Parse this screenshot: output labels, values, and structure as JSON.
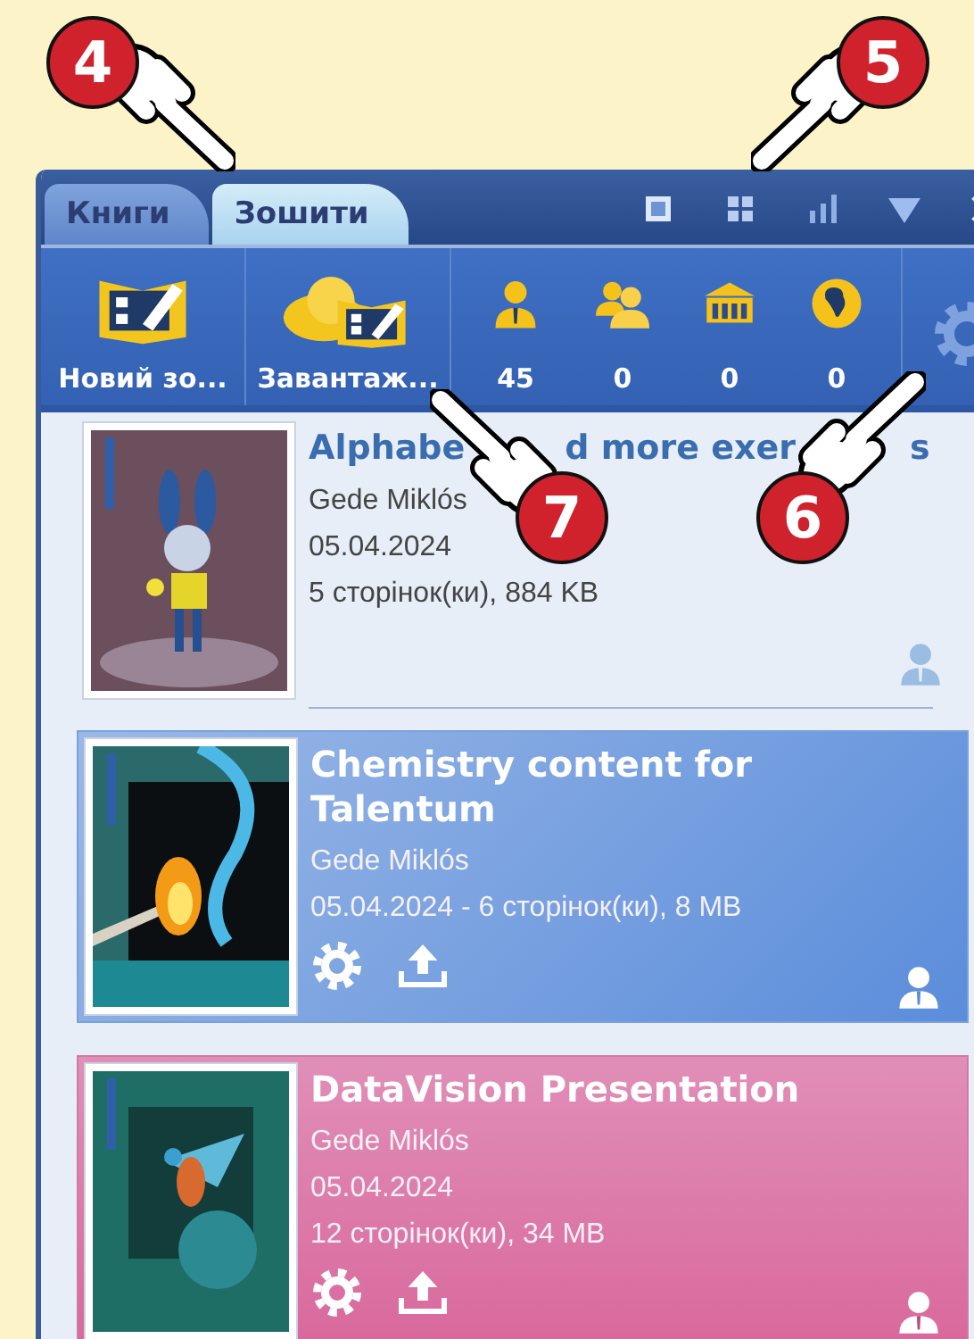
{
  "tabs": [
    {
      "label": "Книги",
      "selected": false
    },
    {
      "label": "Зошити",
      "selected": true
    }
  ],
  "toolbar": {
    "actions": [
      {
        "kind": "new",
        "label": "Новий зо..."
      },
      {
        "kind": "download",
        "label": "Завантаж..."
      }
    ],
    "stats": [
      {
        "kind": "person",
        "count": "45"
      },
      {
        "kind": "group",
        "count": "0"
      },
      {
        "kind": "school",
        "count": "0"
      },
      {
        "kind": "world",
        "count": "0"
      }
    ]
  },
  "items": [
    {
      "kind": "plain",
      "title_parts": [
        "Alphabe",
        "d more exer",
        "s"
      ],
      "author": "Gede Miklós",
      "details": [
        "05.04.2024",
        "5 сторінок(ки), 884 KB"
      ],
      "actions": false
    },
    {
      "kind": "selected",
      "title_parts": [
        "Chemistry content for Talentum"
      ],
      "author": "Gede Miklós",
      "details": [
        "05.04.2024 - 6 сторінок(ки), 8 MB"
      ],
      "actions": true
    },
    {
      "kind": "highlighted",
      "title_parts": [
        "DataVision Presentation"
      ],
      "author": "Gede Miklós",
      "details": [
        "05.04.2024",
        "12 сторінок(ки), 34 MB"
      ],
      "actions": true
    }
  ],
  "callouts": [
    {
      "number": "4"
    },
    {
      "number": "5"
    },
    {
      "number": "7"
    },
    {
      "number": "6"
    }
  ]
}
